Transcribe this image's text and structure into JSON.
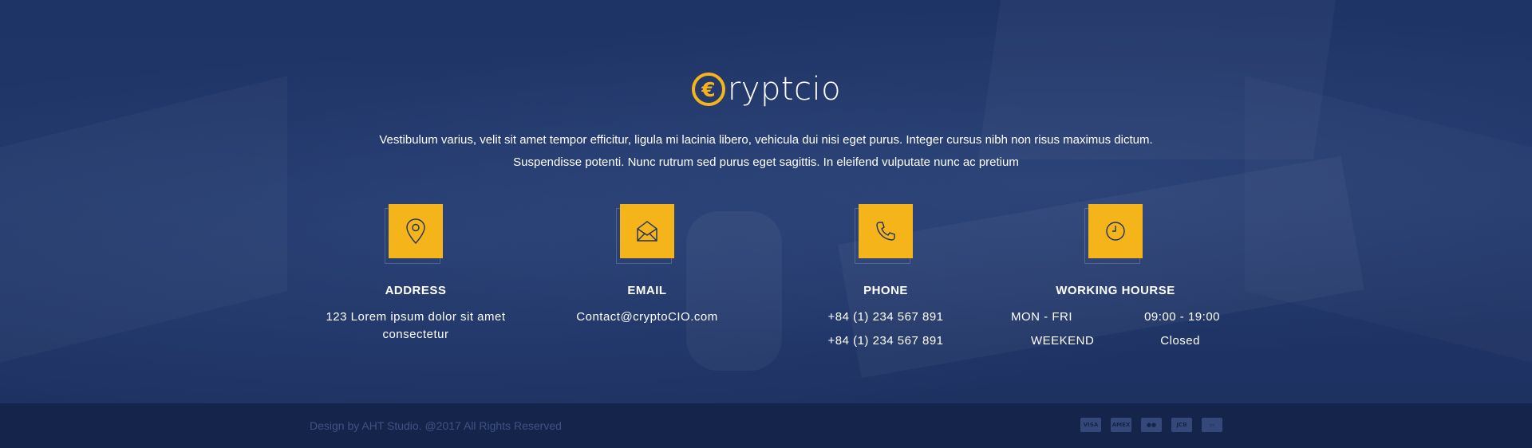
{
  "brand": {
    "name": "ryptcio",
    "coin_symbol": "€",
    "accent_color": "#f4b41a"
  },
  "tagline": "Vestibulum varius, velit sit amet tempor efficitur, ligula mi lacinia libero, vehicula dui nisi eget purus. Integer cursus nibh non risus maximus dictum. Suspendisse potenti. Nunc rutrum sed purus eget sagittis. In eleifend vulputate nunc ac pretium",
  "contacts": {
    "address": {
      "title": "ADDRESS",
      "line1": "123 Lorem ipsum dolor sit amet",
      "line2": "consectetur",
      "icon": "map-pin-icon"
    },
    "email": {
      "title": "EMAIL",
      "value": "Contact@cryptoCIO.com",
      "icon": "envelope-icon"
    },
    "phone": {
      "title": "PHONE",
      "numbers": [
        "+84 (1) 234 567 891",
        "+84 (1) 234 567 891"
      ],
      "icon": "phone-icon"
    },
    "hours": {
      "title": "WORKING HOURSE",
      "rows": [
        {
          "day": "MON - FRI",
          "time": "09:00 - 19:00"
        },
        {
          "day": "WEEKEND",
          "time": "Closed"
        }
      ],
      "icon": "clock-icon"
    }
  },
  "footer": {
    "copyright": "Design by AHT Studio. @2017 All Rights Reserved",
    "payment_icons": [
      "visa-icon",
      "amex-icon",
      "mastercard-icon",
      "jcb-icon",
      "card-icon"
    ],
    "payment_labels": [
      "VISA",
      "AMEX",
      "●●",
      "JCB",
      "▭"
    ]
  }
}
